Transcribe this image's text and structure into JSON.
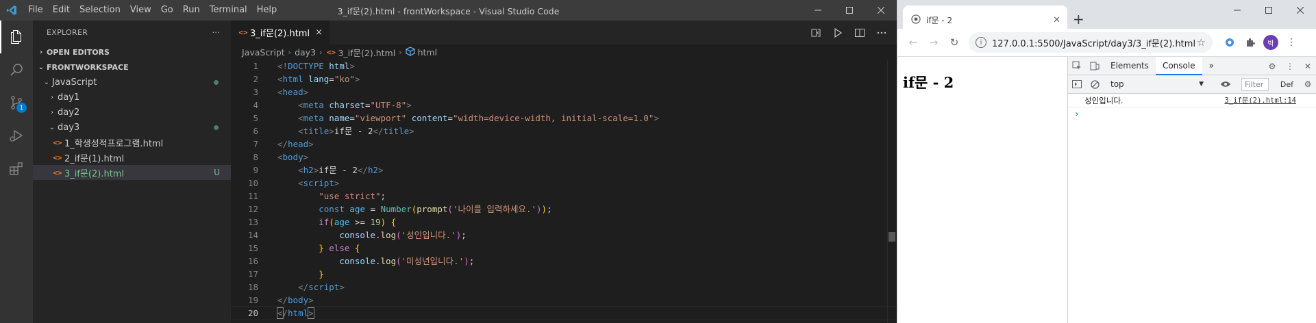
{
  "vscode": {
    "window_title": "3_if문(2).html - frontWorkspace - Visual Studio Code",
    "menu": [
      "File",
      "Edit",
      "Selection",
      "View",
      "Go",
      "Run",
      "Terminal",
      "Help"
    ],
    "activity": {
      "scm_badge": "1"
    },
    "sidebar": {
      "title": "EXPLORER",
      "more": "···",
      "open_editors": "OPEN EDITORS",
      "workspace": "FRONTWORKSPACE",
      "tree": [
        {
          "label": "JavaScript",
          "chevron": "⌄",
          "status": "dot"
        },
        {
          "label": "day1",
          "chevron": "›"
        },
        {
          "label": "day2",
          "chevron": "›"
        },
        {
          "label": "day3",
          "chevron": "⌄",
          "status": "dot"
        },
        {
          "label": "1_학생성적프로그램.html"
        },
        {
          "label": "2_if문(1).html"
        },
        {
          "label": "3_if문(2).html",
          "status": "U"
        }
      ]
    },
    "editor": {
      "tab_label": "3_if문(2).html",
      "tab_close": "×",
      "breadcrumb": [
        "JavaScript",
        "day3",
        "3_if문(2).html",
        "html"
      ],
      "line_numbers": [
        "1",
        "2",
        "3",
        "4",
        "5",
        "6",
        "7",
        "8",
        "9",
        "10",
        "11",
        "12",
        "13",
        "14",
        "15",
        "16",
        "17",
        "18",
        "19",
        "20"
      ]
    }
  },
  "chrome": {
    "tab_title": "if문 - 2",
    "url": "127.0.0.1:5500/JavaScript/day3/3_if문(2).html",
    "avatar_letter": "박",
    "page": {
      "heading": "if문 - 2"
    },
    "devtools": {
      "tabs": [
        "Elements",
        "Console"
      ],
      "active_tab": "Console",
      "more_tabs": "»",
      "context": "top",
      "filter_placeholder": "Filter",
      "levels": "Def",
      "messages": [
        {
          "text": "성인입니다.",
          "source": "3_if문(2).html:14"
        }
      ],
      "prompt": "›"
    }
  },
  "colors": {
    "vscode_bg": "#1e1e1e",
    "accent": "#007acc",
    "git_untracked": "#73c991",
    "html_icon": "#e37933"
  }
}
